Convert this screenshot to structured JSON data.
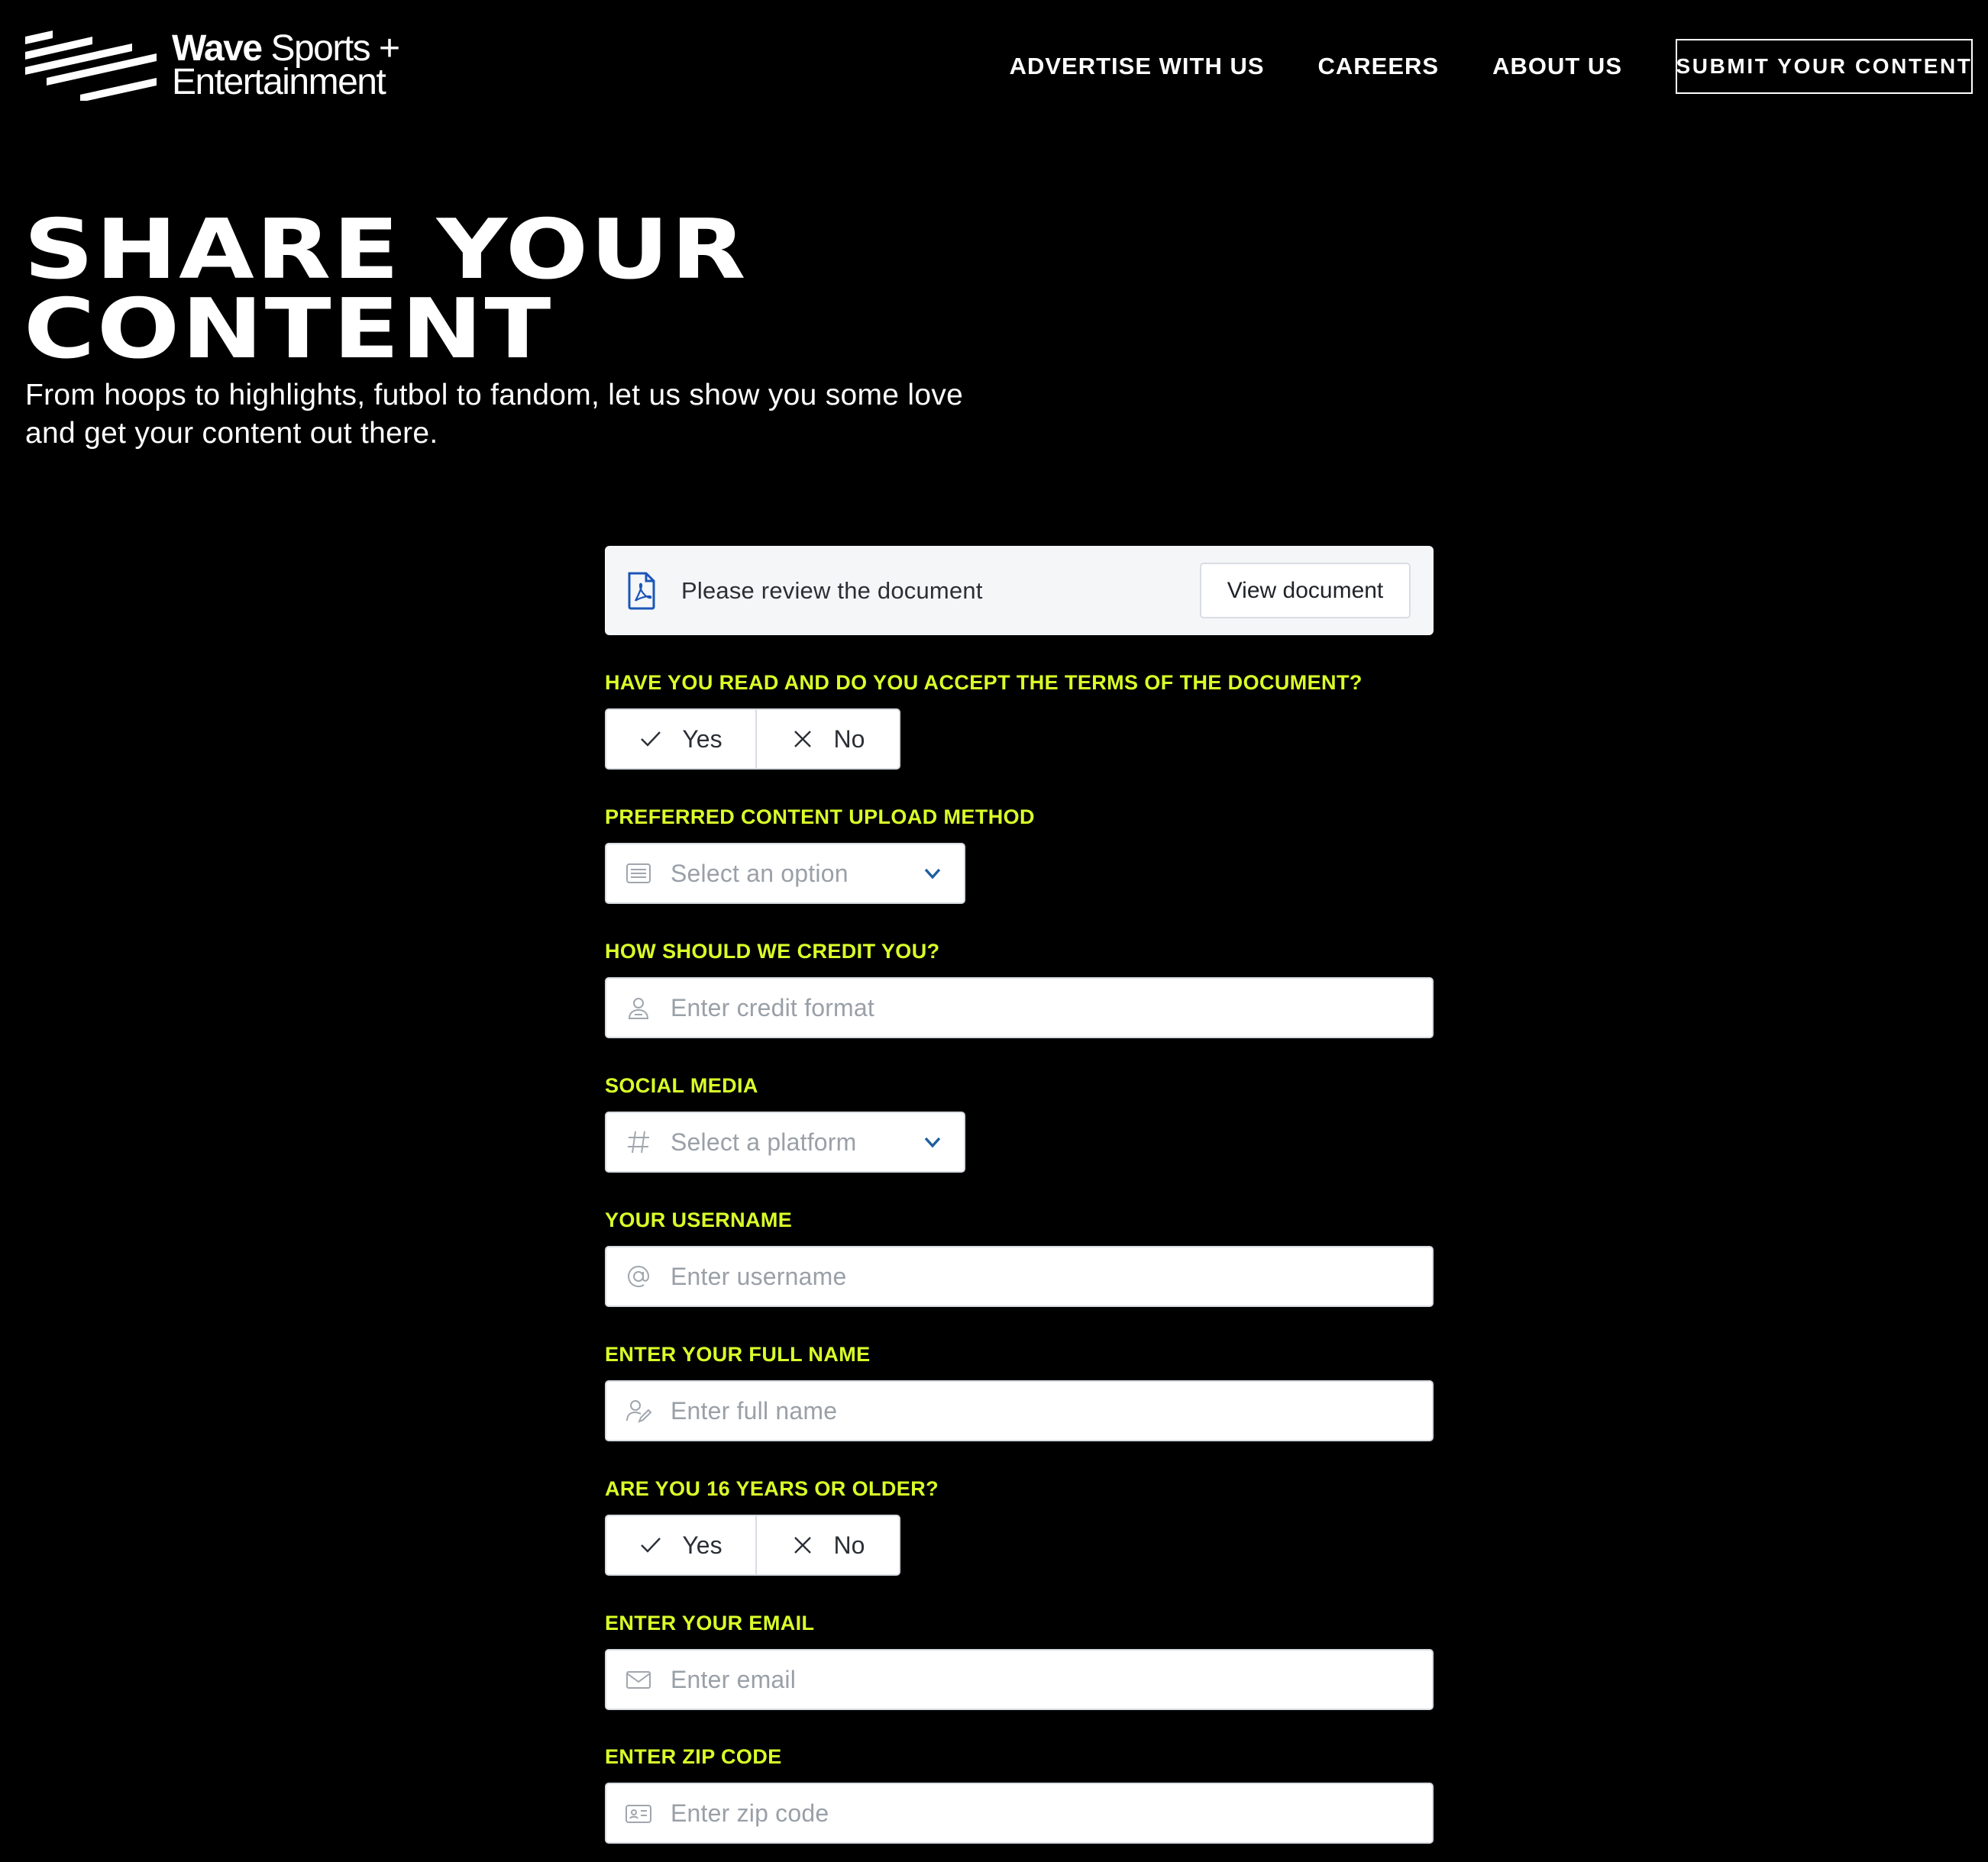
{
  "header": {
    "logo": {
      "line1_bold": "Wave",
      "line1_rest": " Sports +",
      "line2": "Entertainment"
    },
    "nav": [
      {
        "label": "ADVERTISE WITH US"
      },
      {
        "label": "CAREERS"
      },
      {
        "label": "ABOUT US"
      }
    ],
    "cta": "SUBMIT YOUR CONTENT"
  },
  "hero": {
    "title_line1": "SHARE YOUR",
    "title_line2": "CONTENT",
    "subtitle_line1": "From hoops to highlights, futbol to fandom, let us show you some love",
    "subtitle_line2": "and get your content out there."
  },
  "form": {
    "document": {
      "text": "Please review the document",
      "button": "View document"
    },
    "terms": {
      "label": "HAVE YOU READ AND DO YOU ACCEPT THE TERMS OF THE DOCUMENT?",
      "yes": "Yes",
      "no": "No"
    },
    "upload_method": {
      "label": "PREFERRED CONTENT UPLOAD METHOD",
      "placeholder": "Select an option"
    },
    "credit": {
      "label": "HOW SHOULD WE CREDIT YOU?",
      "placeholder": "Enter credit format"
    },
    "social": {
      "label": "SOCIAL MEDIA",
      "placeholder": "Select a platform"
    },
    "username": {
      "label": "YOUR USERNAME",
      "placeholder": "Enter username"
    },
    "full_name": {
      "label": "ENTER YOUR FULL NAME",
      "placeholder": "Enter full name"
    },
    "age": {
      "label": "ARE YOU 16 YEARS OR OLDER?",
      "yes": "Yes",
      "no": "No"
    },
    "email": {
      "label": "ENTER YOUR EMAIL",
      "placeholder": "Enter email"
    },
    "zip": {
      "label": "ENTER ZIP CODE",
      "placeholder": "Enter zip code"
    }
  },
  "colors": {
    "background": "#000000",
    "label_accent": "#dbff28",
    "chevron": "#1f5f9e",
    "doc_icon": "#1a56b8"
  }
}
